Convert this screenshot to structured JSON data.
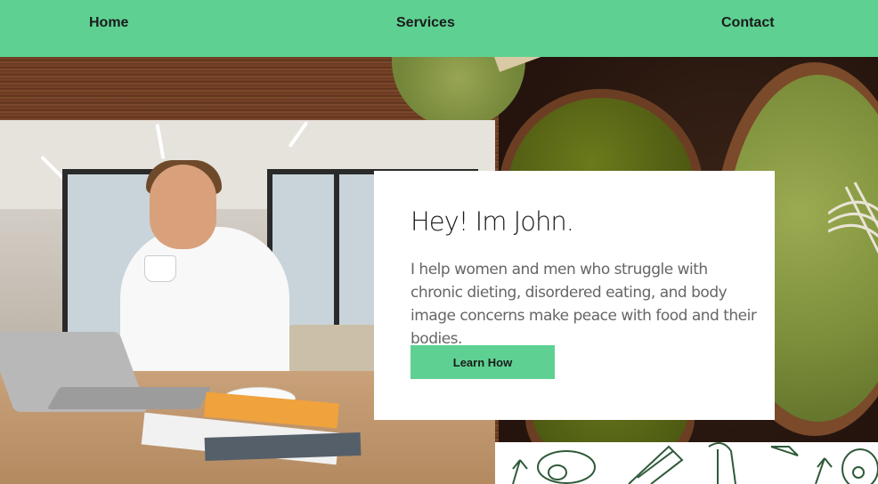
{
  "nav": {
    "items": [
      {
        "label": "Home"
      },
      {
        "label": "Services"
      },
      {
        "label": "Contact"
      }
    ],
    "background": "#5ed192"
  },
  "hero": {
    "title": "Hey! Im John.",
    "description": "I help women and men who struggle with chronic dieting, disordered eating, and body image concerns make peace with food and their bodies.",
    "cta_label": "Learn How",
    "accent": "#5ed192"
  }
}
